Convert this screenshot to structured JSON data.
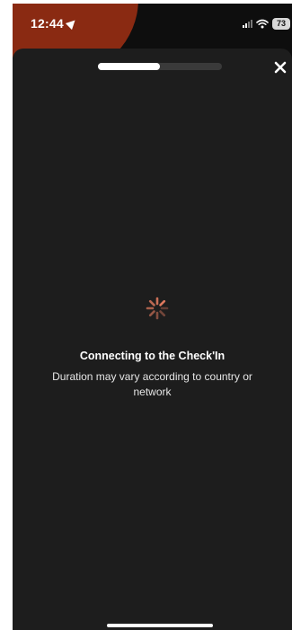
{
  "status_bar": {
    "time": "12:44",
    "battery": "73",
    "icons": [
      "location-arrow-icon",
      "signal-icon",
      "wifi-icon",
      "battery-icon"
    ]
  },
  "header": {
    "progress": 0.5,
    "close_icon": "close-icon"
  },
  "loading": {
    "spinner_icon": "spinner-icon",
    "title": "Connecting to the Check'In",
    "subtitle": "Duration may vary according to country or network"
  },
  "colors": {
    "background": "#1d1d1d",
    "accent": "#e07a5f",
    "status_blob": "#8a2a12"
  }
}
